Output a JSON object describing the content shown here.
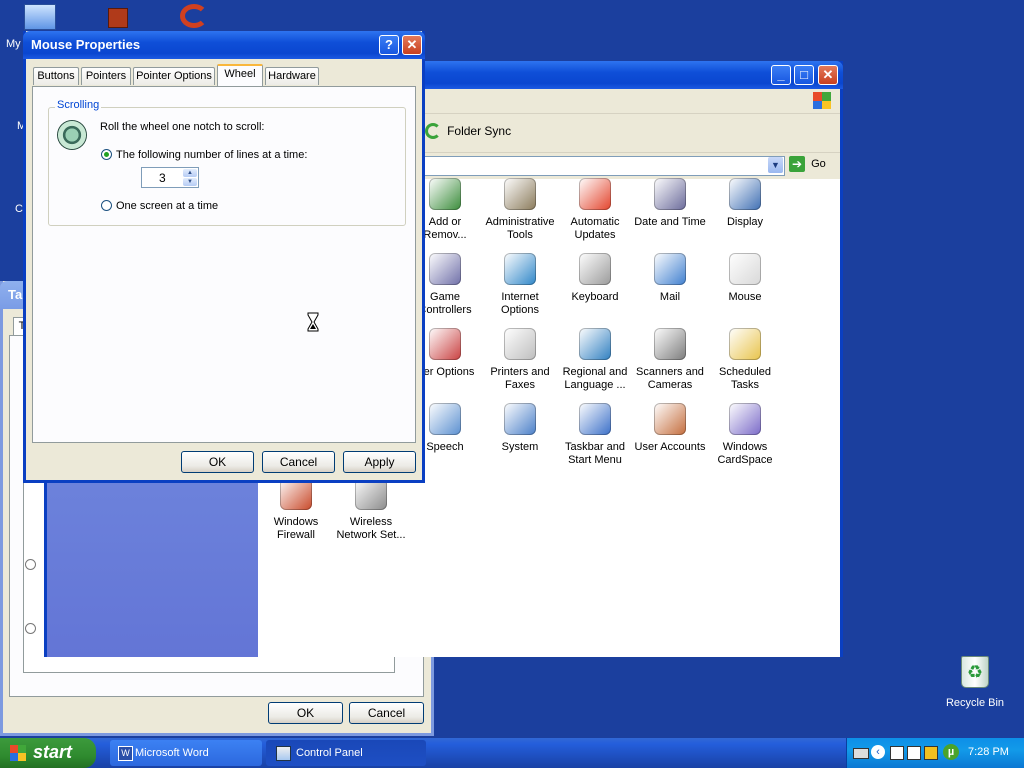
{
  "desktop": {
    "icons": [
      {
        "label": "My",
        "icon": "my-computer-icon"
      },
      {
        "label": "M",
        "icon": "desktop-icon"
      },
      {
        "label": "C",
        "icon": "desktop-icon"
      }
    ],
    "recycle_bin": "Recycle Bin"
  },
  "control_panel": {
    "toolbar_folder_sync": "Folder Sync",
    "go_label": "Go",
    "items": [
      {
        "label": "Add or Remov...",
        "icon": "add-remove-programs-icon",
        "color": "#3a8c3a"
      },
      {
        "label": "Administrative Tools",
        "icon": "administrative-tools-icon",
        "color": "#8a7a5a"
      },
      {
        "label": "Automatic Updates",
        "icon": "windows-logo-icon",
        "color": "#e3432b"
      },
      {
        "label": "Date and Time",
        "icon": "clock-icon",
        "color": "#6a6a9a"
      },
      {
        "label": "Display",
        "icon": "display-icon",
        "color": "#3f6fb3"
      },
      {
        "label": "Game Controllers",
        "icon": "game-controller-icon",
        "color": "#6f6fa8"
      },
      {
        "label": "Internet Options",
        "icon": "globe-icon",
        "color": "#2e86c8"
      },
      {
        "label": "Keyboard",
        "icon": "keyboard-icon",
        "color": "#9a9a9a"
      },
      {
        "label": "Mail",
        "icon": "mail-icon",
        "color": "#3f7fcf"
      },
      {
        "label": "Mouse",
        "icon": "mouse-icon",
        "color": "#d8d8d8"
      },
      {
        "label": "wer Options",
        "icon": "power-options-icon",
        "color": "#c94040"
      },
      {
        "label": "Printers and Faxes",
        "icon": "printer-icon",
        "color": "#bdbdbd"
      },
      {
        "label": "Regional and Language ...",
        "icon": "globe-icon",
        "color": "#2f7fc0"
      },
      {
        "label": "Scanners and Cameras",
        "icon": "scanner-icon",
        "color": "#7c7c7c"
      },
      {
        "label": "Scheduled Tasks",
        "icon": "folder-clock-icon",
        "color": "#e8c34a"
      },
      {
        "label": "Speech",
        "icon": "speech-icon",
        "color": "#5a8fd0"
      },
      {
        "label": "System",
        "icon": "system-icon",
        "color": "#4a7fc8"
      },
      {
        "label": "Taskbar and Start Menu",
        "icon": "taskbar-icon",
        "color": "#3a6fc8"
      },
      {
        "label": "User Accounts",
        "icon": "users-icon",
        "color": "#c46d3c"
      },
      {
        "label": "Windows CardSpace",
        "icon": "cardspace-icon",
        "color": "#7a6ac8"
      },
      {
        "label": "Windows Firewall",
        "icon": "firewall-icon",
        "color": "#c84828"
      },
      {
        "label": "Wireless Network Set...",
        "icon": "wireless-icon",
        "color": "#8a8a8a"
      }
    ]
  },
  "back_dialog": {
    "title_fragment": "Ta",
    "tab_fragment": "T",
    "ok_label": "OK",
    "cancel_label": "Cancel"
  },
  "mouse_properties": {
    "title": "Mouse Properties",
    "help_btn": "?",
    "close_btn": "✕",
    "tabs": [
      "Buttons",
      "Pointers",
      "Pointer Options",
      "Wheel",
      "Hardware"
    ],
    "active_tab": "Wheel",
    "group_label": "Scrolling",
    "roll_text": "Roll the wheel one notch to scroll:",
    "option_lines": "The following number of lines at a time:",
    "lines_value": "3",
    "option_screen": "One screen at a time",
    "ok_label": "OK",
    "cancel_label": "Cancel",
    "apply_label": "Apply"
  },
  "taskbar": {
    "start_label": "start",
    "tasks": [
      {
        "label": "Microsoft Word",
        "icon": "word-icon"
      },
      {
        "label": "Control Panel",
        "icon": "control-panel-icon"
      }
    ],
    "clock": "7:28 PM"
  }
}
